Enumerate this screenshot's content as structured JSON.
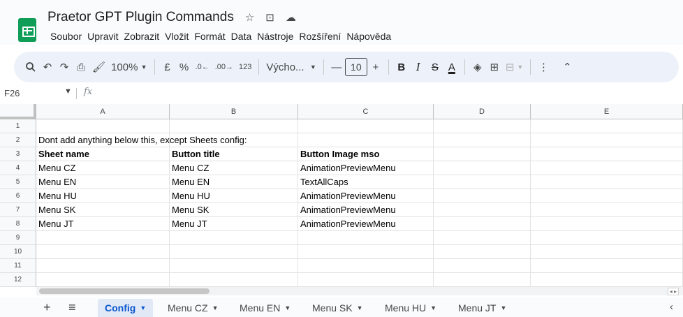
{
  "app": {
    "title": "Praetor GPT Plugin Commands",
    "menu": [
      "Soubor",
      "Upravit",
      "Zobrazit",
      "Vložit",
      "Formát",
      "Data",
      "Nástroje",
      "Rozšíření",
      "Nápověda"
    ]
  },
  "toolbar": {
    "zoom": "100%",
    "currency": "£",
    "percent": "%",
    "dec_decrease": ".0",
    "dec_increase": ".00",
    "number_format": "123",
    "font": "Výcho...",
    "font_size": "10",
    "bold": "B",
    "italic": "I",
    "strike": "S",
    "text_color": "A"
  },
  "formula_bar": {
    "name_box": "F26",
    "fx": "fx"
  },
  "columns": [
    "A",
    "B",
    "C",
    "D",
    "E"
  ],
  "rows": [
    {
      "num": "1",
      "cells": [
        "",
        "",
        ""
      ]
    },
    {
      "num": "2",
      "cells": [
        "Dont add anything below this, except Sheets config:",
        "",
        ""
      ]
    },
    {
      "num": "3",
      "cells": [
        "Sheet name",
        "Button title",
        "Button Image mso"
      ]
    },
    {
      "num": "4",
      "cells": [
        "Menu CZ",
        "Menu CZ",
        "AnimationPreviewMenu"
      ]
    },
    {
      "num": "5",
      "cells": [
        "Menu EN",
        "Menu EN",
        "TextAllCaps"
      ]
    },
    {
      "num": "6",
      "cells": [
        "Menu HU",
        "Menu HU",
        "AnimationPreviewMenu"
      ]
    },
    {
      "num": "7",
      "cells": [
        "Menu SK",
        "Menu SK",
        "AnimationPreviewMenu"
      ]
    },
    {
      "num": "8",
      "cells": [
        "Menu JT",
        "Menu JT",
        "AnimationPreviewMenu"
      ]
    },
    {
      "num": "9",
      "cells": [
        "",
        "",
        ""
      ]
    },
    {
      "num": "10",
      "cells": [
        "",
        "",
        ""
      ]
    },
    {
      "num": "11",
      "cells": [
        "",
        "",
        ""
      ]
    },
    {
      "num": "12",
      "cells": [
        "",
        "",
        ""
      ]
    }
  ],
  "sheet_tabs": [
    {
      "label": "Config",
      "active": true
    },
    {
      "label": "Menu CZ",
      "active": false
    },
    {
      "label": "Menu EN",
      "active": false
    },
    {
      "label": "Menu SK",
      "active": false
    },
    {
      "label": "Menu HU",
      "active": false
    },
    {
      "label": "Menu JT",
      "active": false
    }
  ],
  "colors": {
    "accent": "#0b57d0",
    "sheets_green": "#0f9d58",
    "toolbar_bg": "#edf2fa"
  }
}
